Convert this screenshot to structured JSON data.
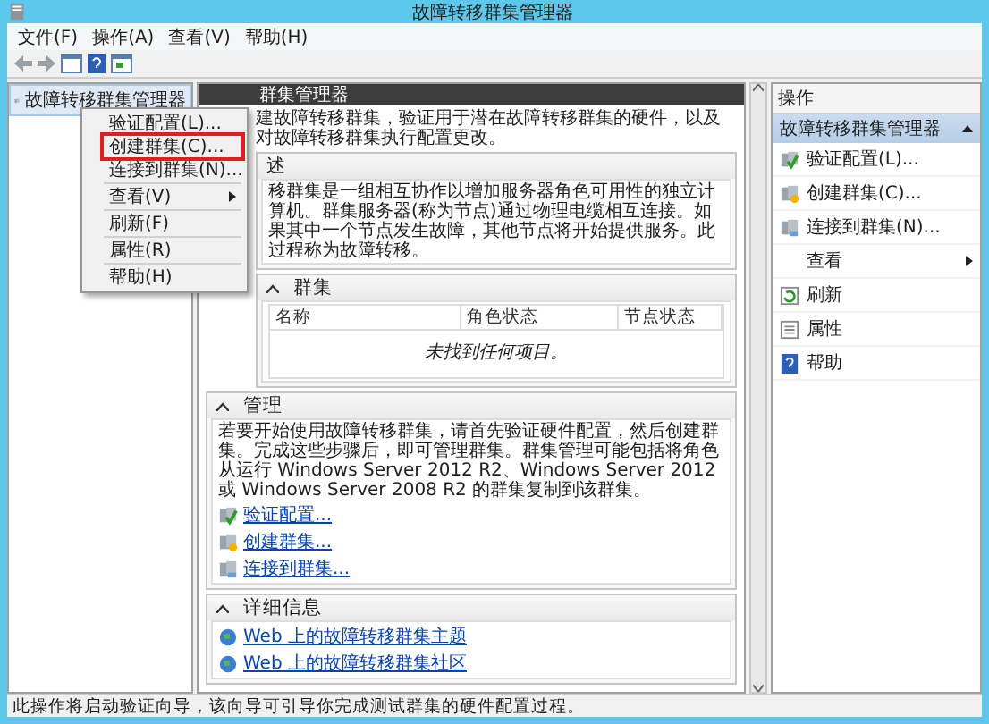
{
  "window": {
    "title": "故障转移群集管理器"
  },
  "menu_bar": [
    "文件(F)",
    "操作(A)",
    "查看(V)",
    "帮助(H)"
  ],
  "tree": {
    "items": [
      {
        "label": "故障转移群集管理器",
        "selected": true
      }
    ]
  },
  "context_menu": {
    "items": [
      {
        "kind": "item",
        "label": "验证配置(L)...",
        "annotated": false
      },
      {
        "kind": "item",
        "label": "创建群集(C)...",
        "annotated": true
      },
      {
        "kind": "item",
        "label": "连接到群集(N)...",
        "annotated": false
      },
      {
        "kind": "separator"
      },
      {
        "kind": "submenu",
        "label": "查看(V)",
        "annotated": false
      },
      {
        "kind": "separator"
      },
      {
        "kind": "item",
        "label": "刷新(F)",
        "annotated": false
      },
      {
        "kind": "separator"
      },
      {
        "kind": "item",
        "label": "属性(R)",
        "annotated": false
      },
      {
        "kind": "separator"
      },
      {
        "kind": "item",
        "label": "帮助(H)",
        "annotated": false
      }
    ]
  },
  "center": {
    "header": "群集管理器",
    "intro": "建故障转移群集，验证用于潜在故障转移群集的硬件，以及对故障转移群集执行配置更改。",
    "sections": [
      {
        "kind": "text",
        "title": "述",
        "text": "移群集是一组相互协作以增加服务器角色可用性的独立计算机。群集服务器(称为节点)通过物理电缆相互连接。如果其中一个节点发生故障，其他节点将开始提供服务。此过程称为故障转移。"
      },
      {
        "kind": "table",
        "title": "群集",
        "expanded": true,
        "columns": [
          "名称",
          "角色状态",
          "节点状态"
        ],
        "empty_message": "未找到任何项目。"
      },
      {
        "kind": "links",
        "title": "管理",
        "expanded": true,
        "text": "若要开始使用故障转移群集，请首先验证硬件配置，然后创建群集。完成这些步骤后，即可管理群集。群集管理可能包括将角色从运行 Windows Server 2012 R2、Windows Server 2012 或 Windows Server 2008 R2 的群集复制到该群集。",
        "links": [
          {
            "kind": "validate",
            "label": "验证配置..."
          },
          {
            "kind": "create",
            "label": "创建群集..."
          },
          {
            "kind": "connect",
            "label": "连接到群集..."
          }
        ]
      },
      {
        "kind": "links",
        "title": "详细信息",
        "expanded": true,
        "links": [
          {
            "kind": "web",
            "label": "Web 上的故障转移群集主题"
          },
          {
            "kind": "web",
            "label": "Web 上的故障转移群集社区"
          }
        ]
      }
    ]
  },
  "actions": {
    "title": "操作",
    "group": {
      "label": "故障转移群集管理器",
      "expanded": true
    },
    "items": [
      {
        "kind": "validate",
        "label": "验证配置(L)..."
      },
      {
        "kind": "create",
        "label": "创建群集(C)..."
      },
      {
        "kind": "connect",
        "label": "连接到群集(N)..."
      },
      {
        "kind": "submenu",
        "label": "查看"
      },
      {
        "kind": "refresh",
        "label": "刷新"
      },
      {
        "kind": "properties",
        "label": "属性"
      },
      {
        "kind": "help",
        "label": "帮助"
      }
    ]
  },
  "status_bar": "此操作将启动验证向导，该向导可引导你完成测试群集的硬件配置过程。"
}
